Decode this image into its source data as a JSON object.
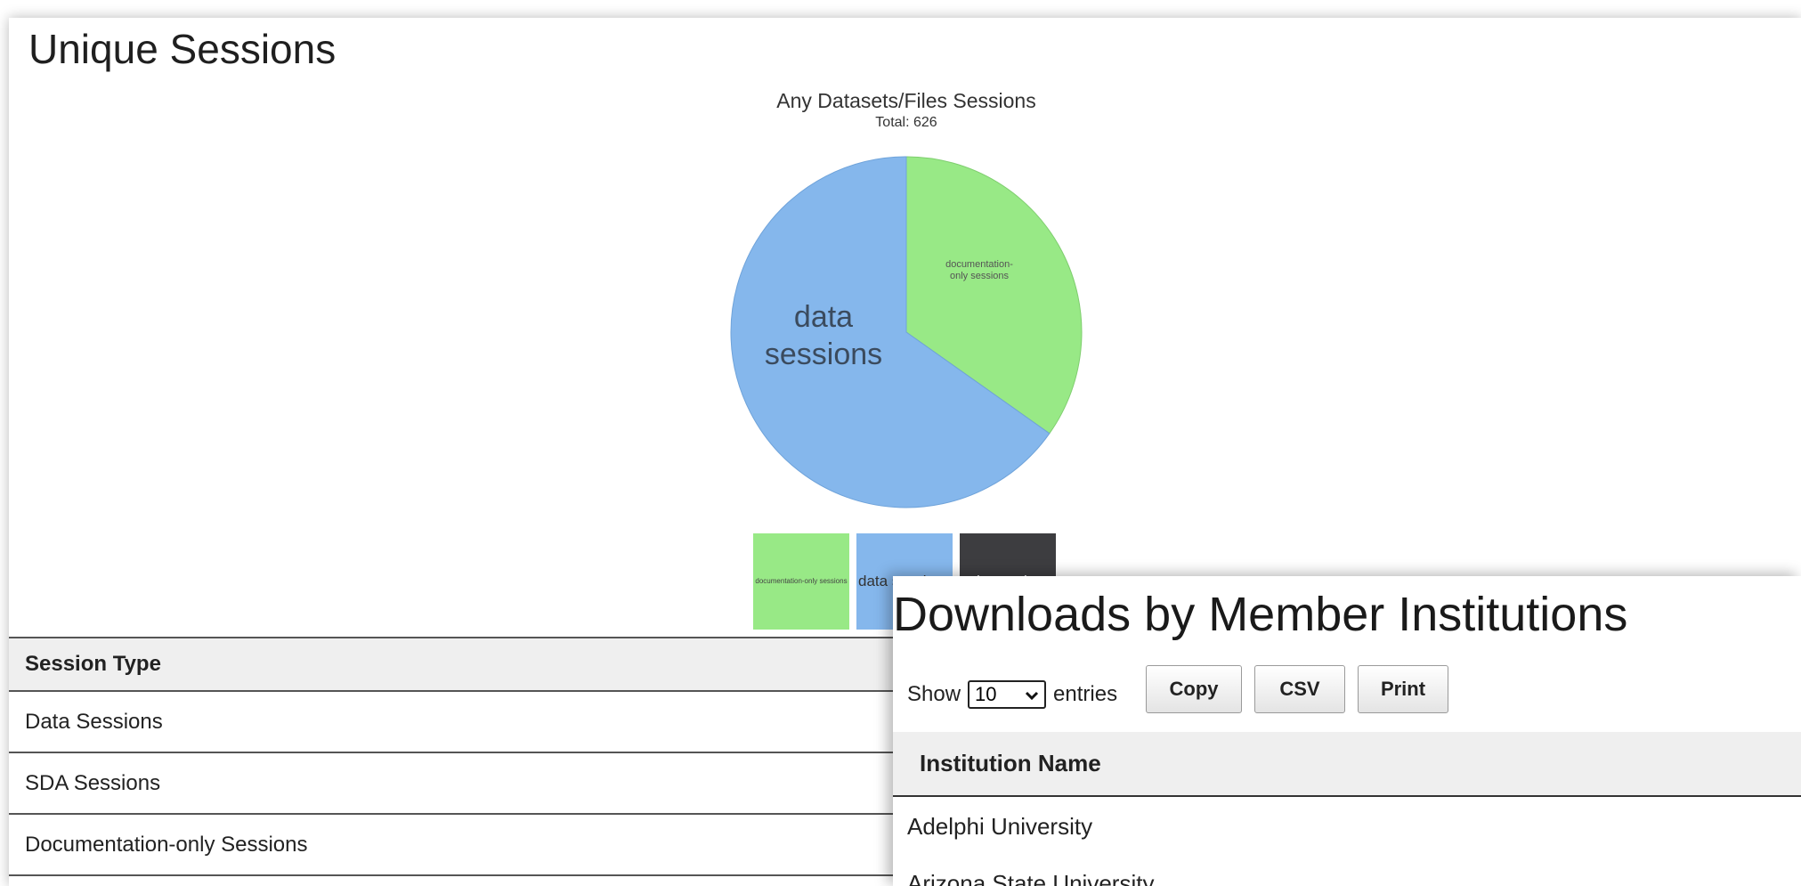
{
  "sessions": {
    "title": "Unique Sessions",
    "table": {
      "header": "Session Type",
      "rows": [
        "Data Sessions",
        "SDA Sessions",
        "Documentation-only Sessions"
      ]
    }
  },
  "chart_data": {
    "type": "pie",
    "title": "Any Datasets/Files Sessions",
    "subtitle": "Total: 626",
    "slices": [
      {
        "label": "documentation-only sessions",
        "value": 0.348,
        "color": "#98e986"
      },
      {
        "label": "data sessions",
        "value": 0.652,
        "color": "#85b7ec"
      }
    ],
    "legend": [
      {
        "label": "documentation-only sessions",
        "color": "#98e986",
        "text_color": "#444444"
      },
      {
        "label": "data sessions",
        "color": "#85b7ec",
        "text_color": "#333333"
      },
      {
        "label": "sda sessions",
        "color": "#3d3d40",
        "text_color": "#ffffff"
      }
    ]
  },
  "downloads": {
    "title": "Downloads by Member Institutions",
    "show_label": "Show",
    "entries_value": "10",
    "entries_label": "entries",
    "buttons": {
      "copy": "Copy",
      "csv": "CSV",
      "print": "Print"
    },
    "table_header": "Institution Name",
    "rows": [
      "Adelphi University",
      "Arizona State University"
    ]
  }
}
